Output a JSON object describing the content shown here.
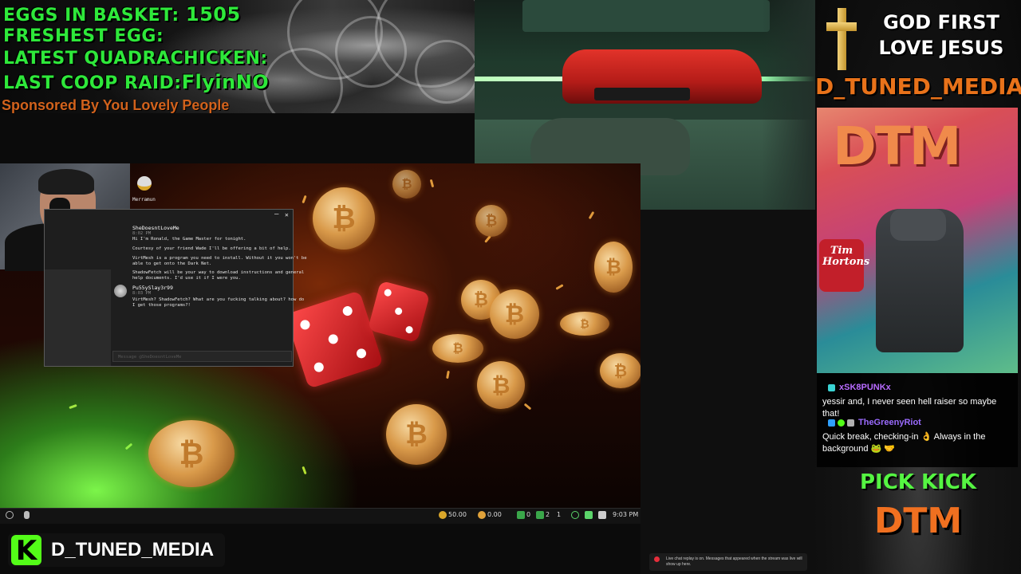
{
  "overlay": {
    "stats": {
      "eggs_label": "EGGS IN BASKET:",
      "eggs_value": "1505",
      "freshest_label": "FRESHEST EGG:",
      "quadrachicken_label": "LATEST QUADRACHICKEN:",
      "coop_raid_label": "LAST COOP RAID:",
      "coop_raid_value": "FlyinNO"
    },
    "sponsor": "Sponsored By You Lovely People",
    "right_header": {
      "line1": "GOD FIRST",
      "line2": "LOVE JESUS",
      "channel": "D_TUNED_MEDIA"
    },
    "tim_sign": "Tim Hortons",
    "dtm_sign": "DTM",
    "pick_kick": "PICK KICK",
    "dtm_big": "DTM",
    "kick_brand": {
      "logo": "K",
      "name": "D_TUNED_MEDIA"
    }
  },
  "chat_overlay": {
    "messages": [
      {
        "user": "xSK8PUNKx",
        "user_color": "#b86bff",
        "text": "yessir and, I never seen hell raiser so maybe that!"
      },
      {
        "user": "TheGreenyRiot",
        "user_color": "#9b6bff",
        "text": "Quick break, checking-in 👌 Always in the background 🐸 🤝"
      }
    ]
  },
  "chat_app": {
    "server_name": "Merramun",
    "window_controls": {
      "minimize": "–",
      "close": "✕"
    },
    "messages": [
      {
        "author": "SheDoesntLoveMe",
        "time": "8:02 PM",
        "lines": [
          "Hi I'm Ronald, the Game Master for tonight.",
          "Courtesy of your friend Wade I'll be offering a bit of help.",
          "VirtMesh is a program you need to install. Without it you won't be",
          "able to get onto the Dark Net.",
          "ShadowFetch will be your way to download instructions and general",
          "help documents. I'd use it if I were you."
        ]
      },
      {
        "author": "Pu55ySlay3r99",
        "time": "8:03 PM",
        "lines": [
          "VirtMesh? ShadowFetch? What are you fucking talking about? how do",
          "I get those programs?!"
        ]
      }
    ],
    "input_placeholder": "Message @SheDoesntLoveMe"
  },
  "taskbar": {
    "balance_1": "50.00",
    "balance_2": "0.00",
    "count_1": "0",
    "count_2": "2",
    "count_3": "1",
    "time": "9:03 PM"
  },
  "replay_notice": "Live chat replay is on. Messages that appeared when the stream was live will show up here.",
  "colors": {
    "stat_green": "#2ee83a",
    "sponsor_orange": "#d2621c",
    "channel_orange": "#e8721a",
    "kick_green": "#53fc18"
  }
}
